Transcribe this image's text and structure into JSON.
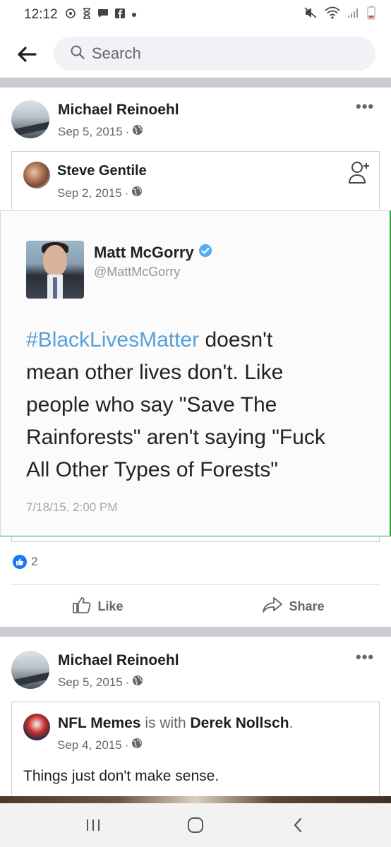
{
  "status_bar": {
    "time": "12:12",
    "icons_left": [
      "data-saver-icon",
      "hourglass-icon",
      "chat-icon",
      "facebook-icon",
      "dot-icon"
    ],
    "icons_right": [
      "mute-icon",
      "wifi-icon",
      "signal-icon",
      "battery-icon"
    ]
  },
  "search": {
    "placeholder": "Search"
  },
  "posts": [
    {
      "author": "Michael Reinoehl",
      "date": "Sep 5, 2015",
      "privacy_icon": "globe-icon",
      "shared": {
        "author": "Steve Gentile",
        "date": "Sep 2, 2015",
        "action_icon": "add-friend-icon",
        "tweet": {
          "name": "Matt McGorry",
          "handle": "@MattMcGorry",
          "verified": true,
          "hashtag": "#BlackLivesMatter",
          "text_line1_rest": " doesn't",
          "text_line2": "mean other lives don't. Like",
          "text_line3": "people who say \"Save The",
          "text_line4": "Rainforests\" aren't saying \"Fuck",
          "text_line5": "All Other Types of Forests\"",
          "timestamp": "7/18/15, 2:00 PM",
          "hashtag_color": "#5aa0d6"
        }
      },
      "reactions": {
        "count": "2",
        "icon": "like-badge-icon"
      },
      "actions": {
        "like": "Like",
        "share": "Share"
      }
    },
    {
      "author": "Michael Reinoehl",
      "date": "Sep 5, 2015",
      "privacy_icon": "globe-icon",
      "shared": {
        "page": "NFL Memes",
        "with_text": " is with ",
        "tagged": "Derek Nollsch",
        "period": ".",
        "date": "Sep 4, 2015",
        "text": "Things just don't make sense."
      }
    }
  ],
  "nav": {
    "recent": "recent-apps-icon",
    "home": "home-icon",
    "back": "back-icon"
  },
  "colors": {
    "facebook_blue": "#1877f2",
    "secondary_text": "#65676b",
    "divider": "#c9ccd1"
  }
}
